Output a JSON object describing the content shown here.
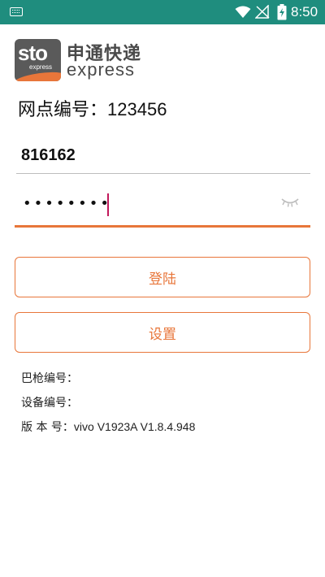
{
  "status_bar": {
    "time": "8:50",
    "icons": [
      "keyboard-icon",
      "wifi-icon",
      "no-signal-icon",
      "battery-charging-icon"
    ],
    "background": "#1f8d7e"
  },
  "logo": {
    "badge_text": "sto",
    "badge_small": "express",
    "name_cn": "申通快递",
    "name_en": "express"
  },
  "station": {
    "label": "网点编号：",
    "value": "123456"
  },
  "login": {
    "username": "816162",
    "password_mask": "••••••••",
    "password_toggle_icon": "eye-closed-icon"
  },
  "buttons": {
    "login_label": "登陆",
    "settings_label": "设置"
  },
  "info": {
    "gun_label": "巴枪编号：",
    "gun_value": "",
    "device_label": "设备编号：",
    "device_value": "",
    "version_label": "版 本 号：",
    "version_value": "vivo V1923A V1.8.4.948"
  },
  "colors": {
    "accent": "#e8763a",
    "caret": "#c2185b"
  }
}
